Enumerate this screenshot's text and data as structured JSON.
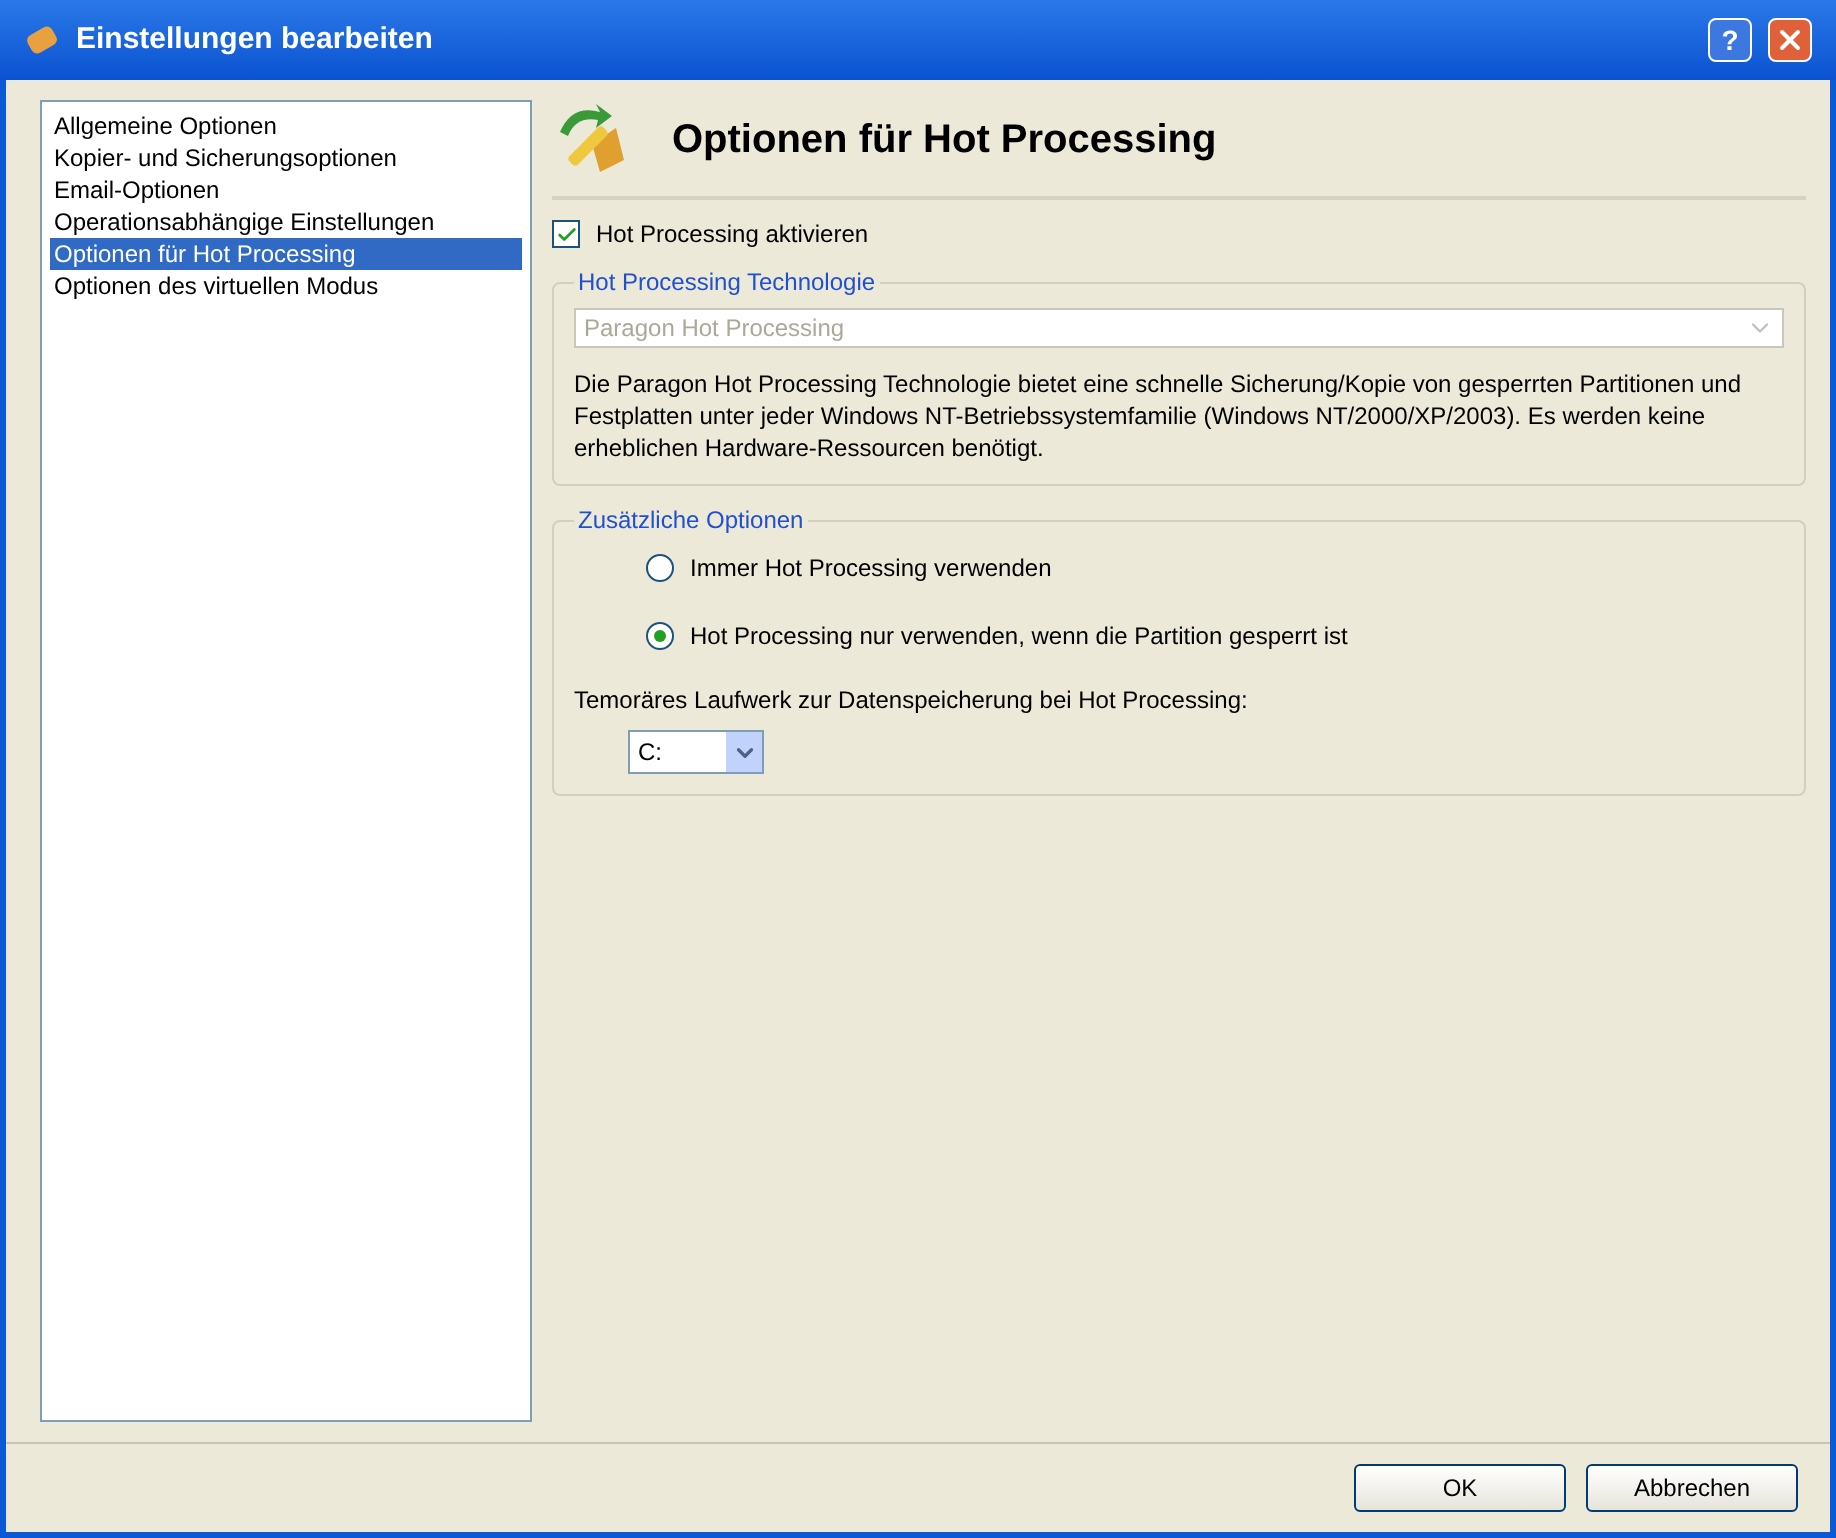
{
  "window": {
    "title": "Einstellungen bearbeiten",
    "help_button": "?"
  },
  "sidebar": {
    "items": [
      {
        "label": "Allgemeine Optionen",
        "selected": false
      },
      {
        "label": "Kopier- und Sicherungsoptionen",
        "selected": false
      },
      {
        "label": "Email-Optionen",
        "selected": false
      },
      {
        "label": "Operationsabhängige Einstellungen",
        "selected": false
      },
      {
        "label": "Optionen für Hot Processing",
        "selected": true
      },
      {
        "label": "Optionen des virtuellen Modus",
        "selected": false
      }
    ]
  },
  "page": {
    "title": "Optionen für Hot Processing",
    "enable": {
      "label": "Hot Processing aktivieren",
      "checked": true
    },
    "technology": {
      "legend": "Hot Processing Technologie",
      "select": {
        "value": "Paragon Hot Processing",
        "disabled": true
      },
      "description": "Die Paragon Hot Processing Technologie bietet eine schnelle Sicherung/Kopie von gesperrten Partitionen und Festplatten unter jeder Windows NT-Betriebssystemfamilie (Windows NT/2000/XP/2003). Es werden keine erheblichen Hardware-Ressourcen benötigt."
    },
    "extra": {
      "legend": "Zusätzliche Optionen",
      "radios": [
        {
          "label": "Immer Hot Processing verwenden",
          "selected": false
        },
        {
          "label": "Hot Processing nur verwenden, wenn die Partition gesperrt ist",
          "selected": true
        }
      ],
      "drive_label": "Temoräres Laufwerk zur Datenspeicherung bei Hot Processing:",
      "drive": {
        "value": "C:"
      }
    }
  },
  "buttons": [
    {
      "label": "OK"
    },
    {
      "label": "Abbrechen"
    }
  ]
}
